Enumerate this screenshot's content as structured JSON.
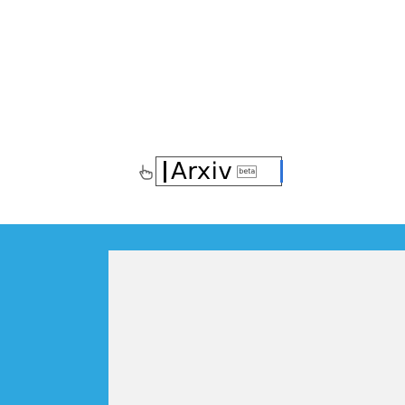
{
  "brand": {
    "wordmark": "Arxiv",
    "badge": "beta",
    "logo_icon": "hand-pointer-icon"
  },
  "colors": {
    "accent": "#2ea7df",
    "background": "#ffffff",
    "panel": "#f2f2f2"
  }
}
